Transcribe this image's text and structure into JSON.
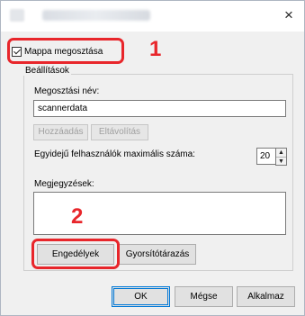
{
  "window": {
    "close_glyph": "×"
  },
  "share": {
    "checkbox_label": "Mappa megosztása",
    "checked": true
  },
  "settings": {
    "group_label": "Beállítások",
    "share_name_label": "Megosztási név:",
    "share_name_value": "scannerdata",
    "add_button": "Hozzáadás",
    "remove_button": "Eltávolítás",
    "max_users_label": "Egyidejű felhasználók maximális száma:",
    "max_users_value": "20",
    "comments_label": "Megjegyzések:",
    "comments_value": "",
    "permissions_button": "Engedélyek",
    "caching_button": "Gyorsítótárazás"
  },
  "footer": {
    "ok": "OK",
    "cancel": "Mégse",
    "apply": "Alkalmaz"
  },
  "callouts": {
    "one": "1",
    "two": "2"
  },
  "accent_color": "#e8262b"
}
